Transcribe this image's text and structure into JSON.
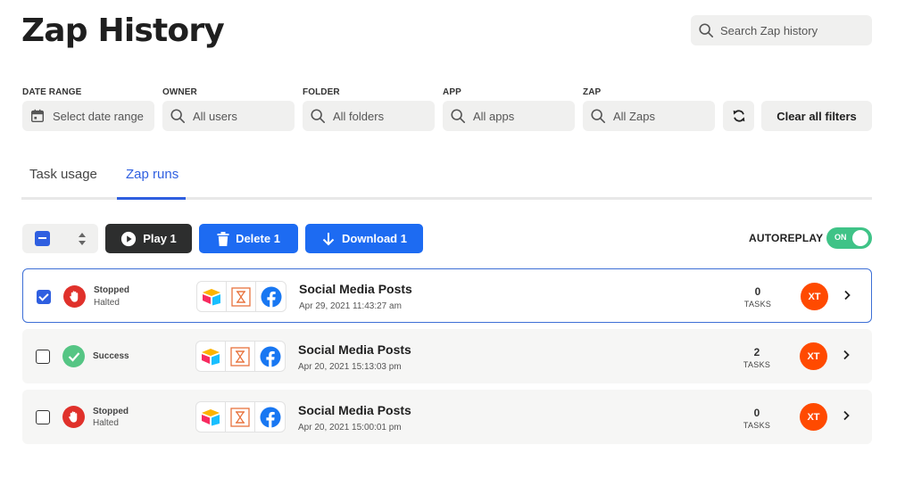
{
  "header": {
    "title": "Zap History",
    "search_placeholder": "Search Zap history"
  },
  "filters": [
    {
      "label": "DATE RANGE",
      "placeholder": "Select date range",
      "icon": "calendar-icon"
    },
    {
      "label": "OWNER",
      "placeholder": "All users",
      "icon": "search-icon"
    },
    {
      "label": "FOLDER",
      "placeholder": "All folders",
      "icon": "search-icon"
    },
    {
      "label": "APP",
      "placeholder": "All apps",
      "icon": "search-icon"
    },
    {
      "label": "ZAP",
      "placeholder": "All Zaps",
      "icon": "search-icon"
    }
  ],
  "clear_filters_label": "Clear all filters",
  "tabs": [
    {
      "label": "Task usage",
      "active": false
    },
    {
      "label": "Zap runs",
      "active": true
    }
  ],
  "toolbar": {
    "play_label": "Play 1",
    "delete_label": "Delete 1",
    "download_label": "Download 1",
    "autoreplay_label": "AUTOREPLAY",
    "autoreplay_state": "ON"
  },
  "colors": {
    "accent_blue": "#1d6bf2",
    "stopped_red": "#e0312b",
    "success_green": "#55c584",
    "toggle_green": "#3fc387",
    "avatar_orange": "#ff4a00"
  },
  "runs": [
    {
      "selected": true,
      "status": "Stopped",
      "substatus": "Halted",
      "status_type": "stopped",
      "zap_name": "Social Media Posts",
      "date": "Apr 29, 2021 11:43:27 am",
      "tasks": "0",
      "tasks_label": "TASKS",
      "owner_initials": "XT",
      "apps": [
        "airtable-icon",
        "delay-hourglass-icon",
        "facebook-icon"
      ]
    },
    {
      "selected": false,
      "status": "Success",
      "substatus": "",
      "status_type": "success",
      "zap_name": "Social Media Posts",
      "date": "Apr 20, 2021 15:13:03 pm",
      "tasks": "2",
      "tasks_label": "TASKS",
      "owner_initials": "XT",
      "apps": [
        "airtable-icon",
        "delay-hourglass-icon",
        "facebook-icon"
      ]
    },
    {
      "selected": false,
      "status": "Stopped",
      "substatus": "Halted",
      "status_type": "stopped",
      "zap_name": "Social Media Posts",
      "date": "Apr 20, 2021 15:00:01 pm",
      "tasks": "0",
      "tasks_label": "TASKS",
      "owner_initials": "XT",
      "apps": [
        "airtable-icon",
        "delay-hourglass-icon",
        "facebook-icon"
      ]
    }
  ]
}
